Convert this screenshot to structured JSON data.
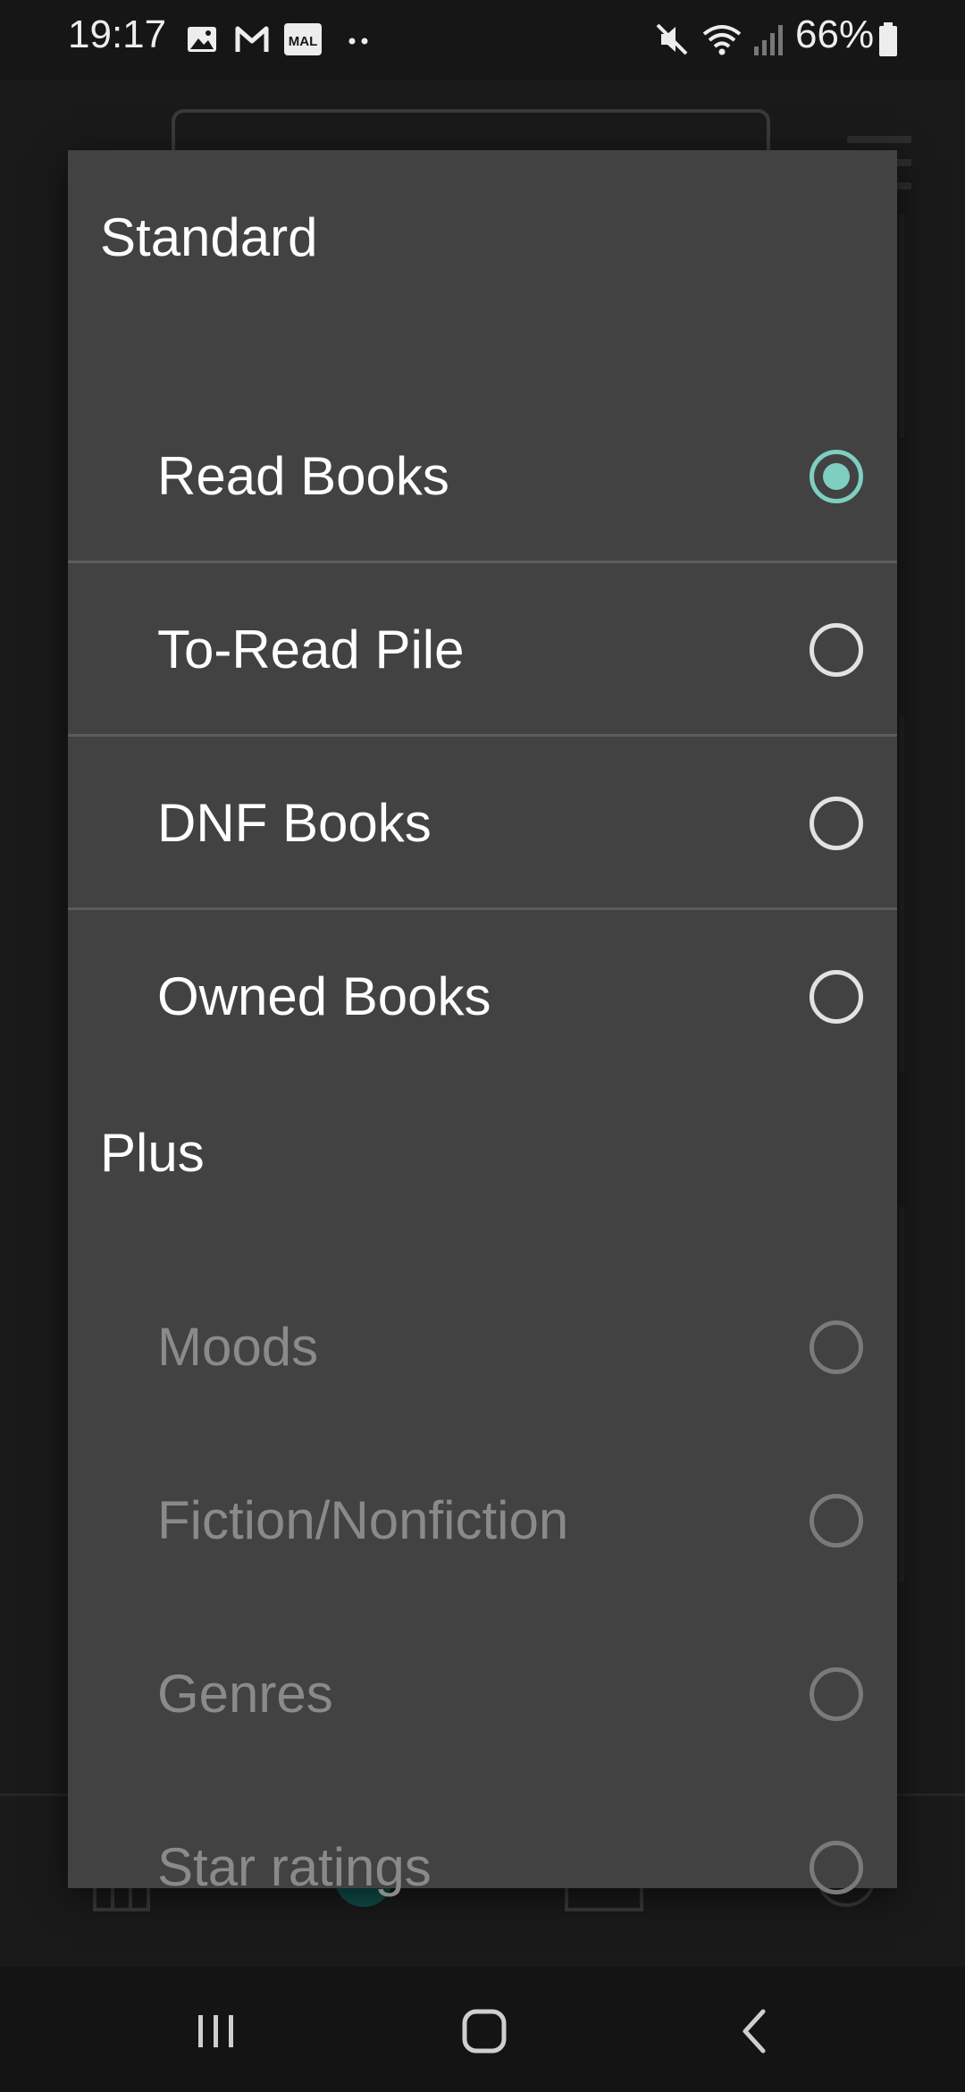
{
  "status_bar": {
    "time": "19:17",
    "battery": "66%",
    "notification_icons": [
      "image-icon",
      "gmail-icon",
      "mal-icon",
      "more-dots-icon"
    ],
    "mal_label": "MAL",
    "system_icons": [
      "mute-icon",
      "wifi-icon",
      "signal-icon",
      "battery-icon"
    ]
  },
  "dialog": {
    "sections": [
      {
        "header": "Standard",
        "options": [
          {
            "label": "Read Books",
            "selected": true,
            "enabled": true
          },
          {
            "label": "To-Read Pile",
            "selected": false,
            "enabled": true
          },
          {
            "label": "DNF Books",
            "selected": false,
            "enabled": true
          },
          {
            "label": "Owned Books",
            "selected": false,
            "enabled": true
          }
        ]
      },
      {
        "header": "Plus",
        "options": [
          {
            "label": "Moods",
            "selected": false,
            "enabled": false
          },
          {
            "label": "Fiction/Nonfiction",
            "selected": false,
            "enabled": false
          },
          {
            "label": "Genres",
            "selected": false,
            "enabled": false
          },
          {
            "label": "Star ratings",
            "selected": false,
            "enabled": false
          }
        ]
      }
    ]
  },
  "nav_bar": {
    "buttons": [
      "recent-apps-icon",
      "home-icon",
      "back-icon"
    ]
  },
  "colors": {
    "accent": "#7ecfc2",
    "dialog_bg": "#424242",
    "screen_bg": "#161616",
    "disabled_text": "#8a8a8a"
  }
}
